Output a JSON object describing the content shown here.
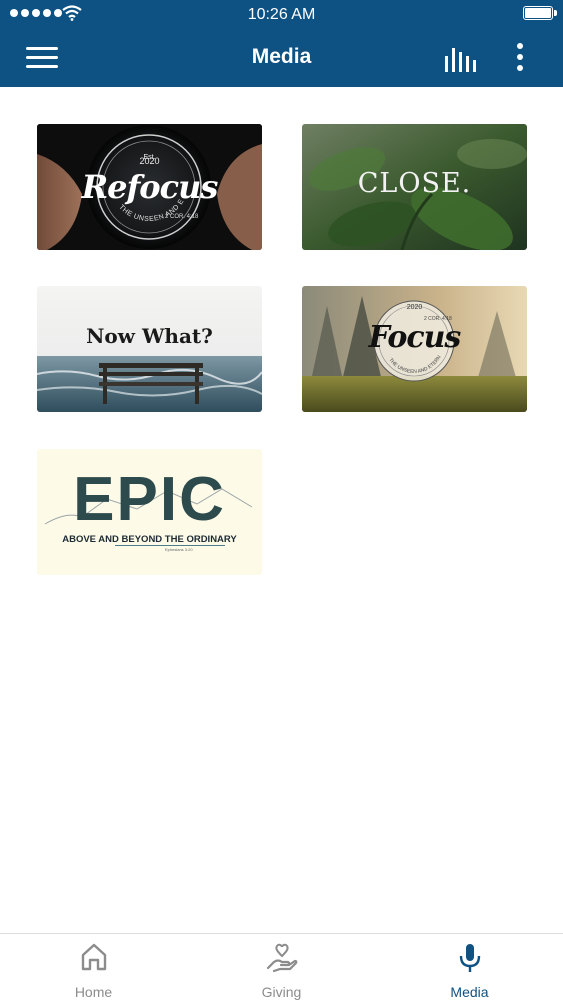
{
  "status_bar": {
    "time": "10:26 AM"
  },
  "header": {
    "title": "Media"
  },
  "media_items": [
    {
      "title": "Refocus",
      "year": "2020",
      "est": "Est.",
      "ref": "2 COR. 4:18",
      "arc": "THE UNSEEN AND ETERNAL"
    },
    {
      "title": "CLOSE."
    },
    {
      "title": "Now What?"
    },
    {
      "title": "Focus",
      "year": "2020",
      "ref": "2 COR. 4:18",
      "arc": "THE UNSEEN AND ETERNAL"
    },
    {
      "title": "EPIC",
      "subtitle": "ABOVE AND BEYOND THE ORDINARY",
      "ref": "Ephesians 3:20"
    }
  ],
  "tab_bar": {
    "items": [
      {
        "label": "Home",
        "icon": "home-icon",
        "active": false
      },
      {
        "label": "Giving",
        "icon": "giving-hand-heart-icon",
        "active": false
      },
      {
        "label": "Media",
        "icon": "microphone-icon",
        "active": true
      }
    ]
  },
  "colors": {
    "brand": "#0e5284",
    "tab_inactive": "#8c8c8c",
    "tab_active": "#0e5284"
  }
}
